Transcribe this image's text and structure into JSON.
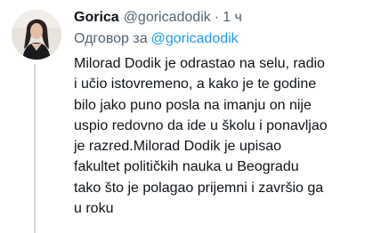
{
  "author": {
    "name": "Gorica",
    "handle": "@goricadodik",
    "time": "1 ч"
  },
  "reply": {
    "label": "Одговор за",
    "mention": "@goricadodik"
  },
  "tweet": {
    "lines": [
      "Milorad Dodik je odrastao na selu, radio",
      "i učio istovremeno, a kako je te godine",
      "bilo jako puno posla na imanju on nije",
      "uspio redovno da ide u školu i ponavljao",
      "je razred.Milorad Dodik je upisao",
      "fakultet političkih nauka u Beogradu",
      "tako što je polagao prijemni i završio ga",
      "u roku"
    ]
  },
  "icons": {
    "more": "more-options-icon",
    "avatar": "profile-avatar"
  },
  "colors": {
    "text": "#0f1419",
    "secondary": "#536471",
    "link": "#1d9bf0"
  }
}
